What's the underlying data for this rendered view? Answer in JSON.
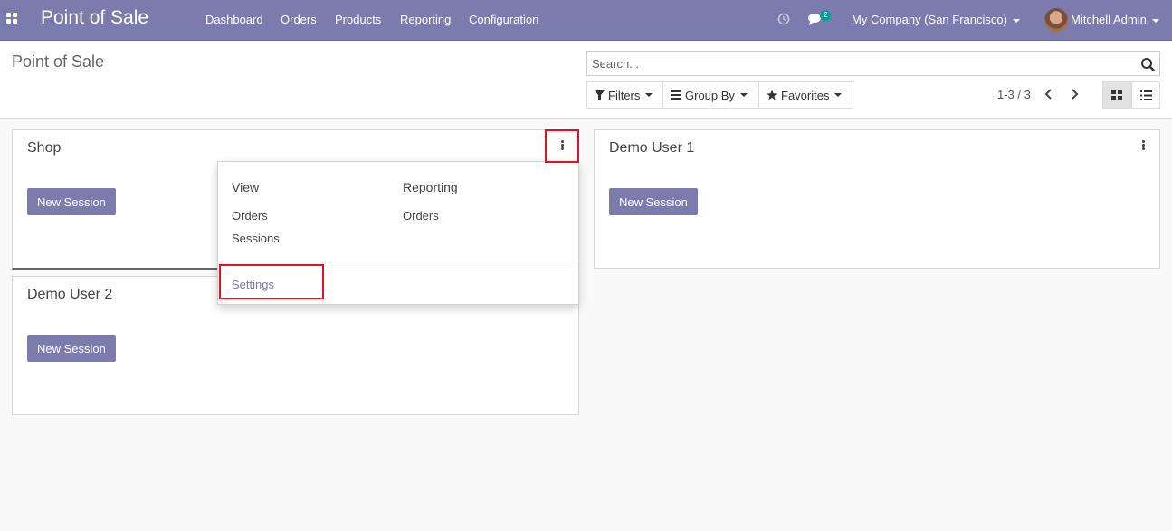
{
  "navbar": {
    "brand": "Point of Sale",
    "menus": [
      "Dashboard",
      "Orders",
      "Products",
      "Reporting",
      "Configuration"
    ],
    "messages_badge": "2",
    "company": "My Company (San Francisco)",
    "user": "Mitchell Admin"
  },
  "control_panel": {
    "title": "Point of Sale",
    "search_placeholder": "Search...",
    "filters_label": "Filters",
    "group_by_label": "Group By",
    "favorites_label": "Favorites",
    "pager": "1-3 / 3"
  },
  "cards": [
    {
      "name": "Shop",
      "button": "New Session"
    },
    {
      "name": "Demo User 1",
      "button": "New Session"
    },
    {
      "name": "Demo User 2",
      "button": "New Session"
    }
  ],
  "dropdown": {
    "view_heading": "View",
    "view_items": [
      "Orders",
      "Sessions"
    ],
    "reporting_heading": "Reporting",
    "reporting_items": [
      "Orders"
    ],
    "settings": "Settings"
  },
  "colors": {
    "brand": "#7c7bad",
    "highlight": "#e0141e",
    "badge": "#00a09d"
  }
}
